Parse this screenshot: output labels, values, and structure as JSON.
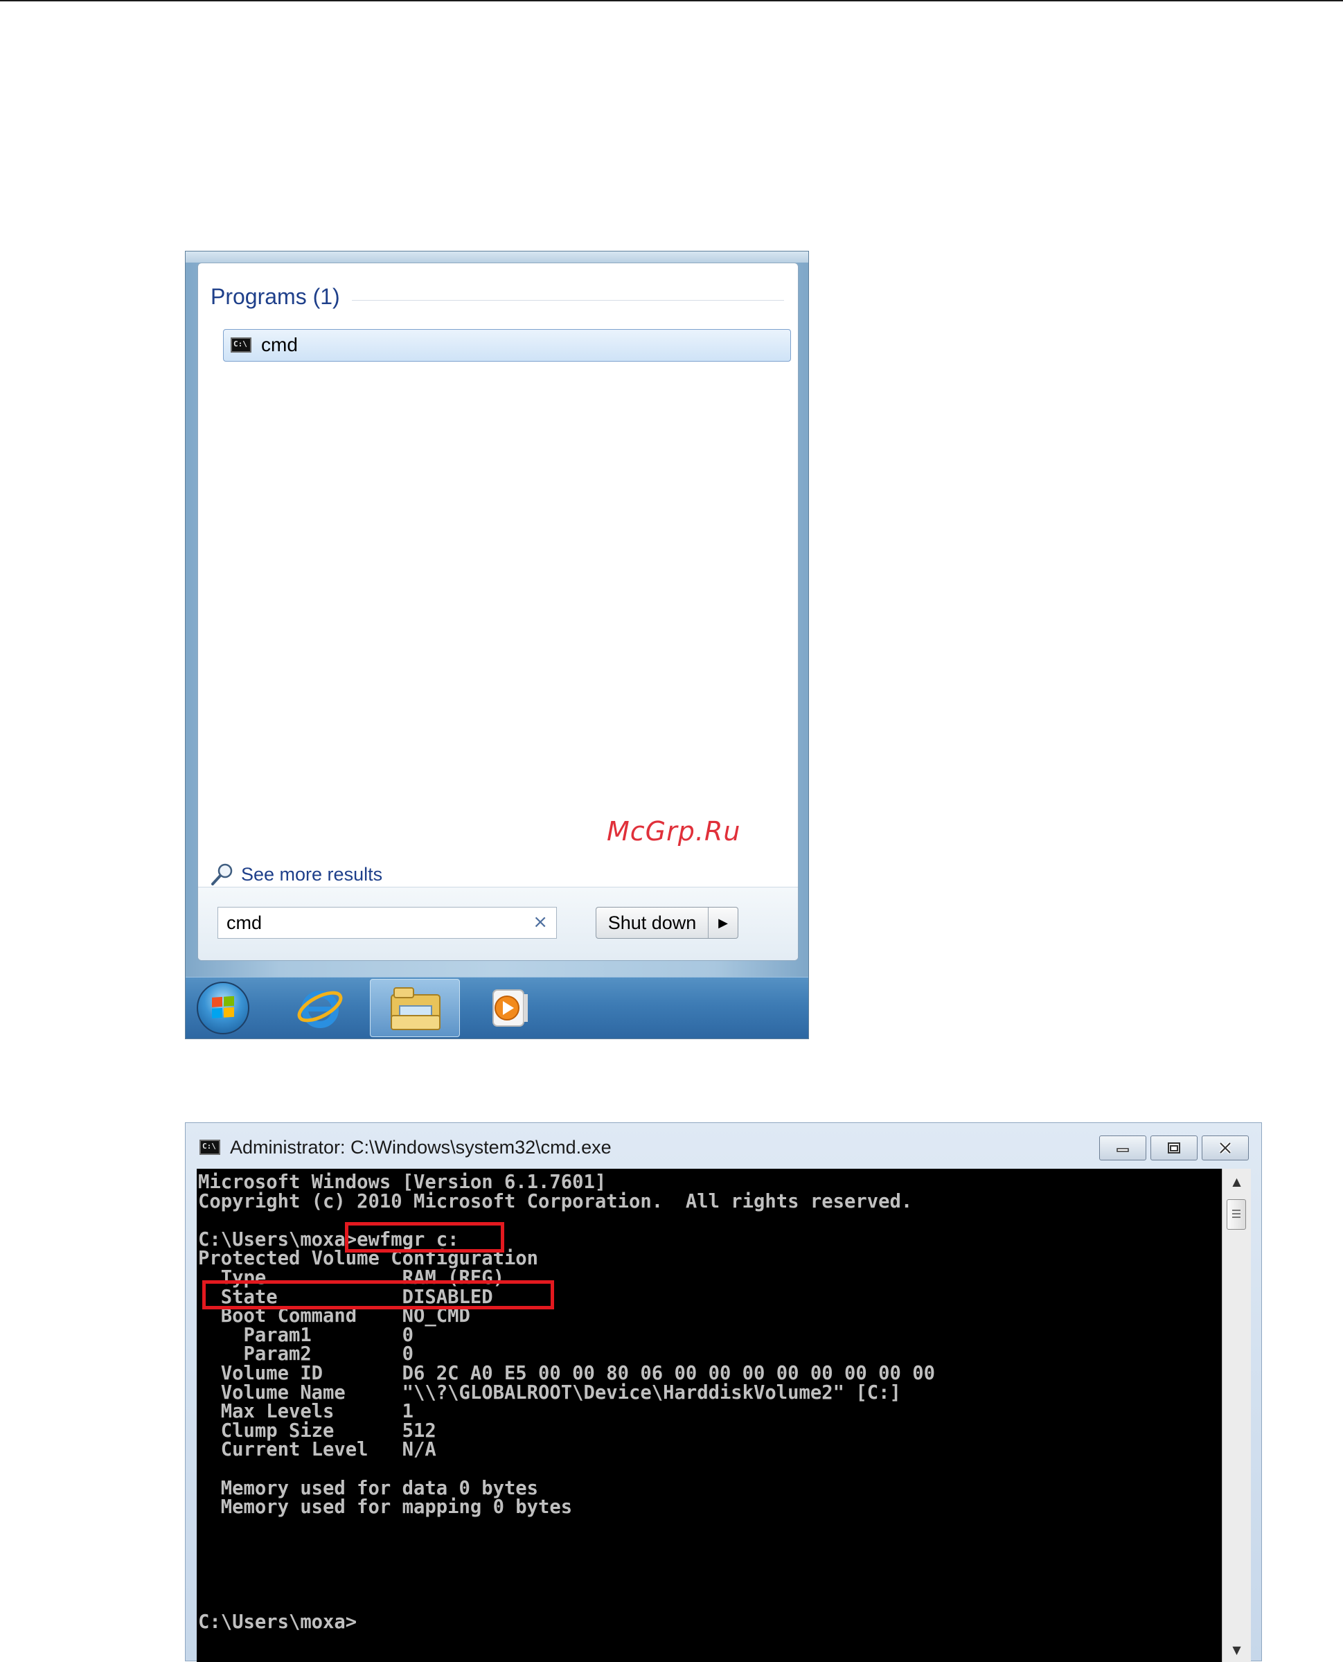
{
  "start_menu": {
    "programs_heading": "Programs (1)",
    "program_items": [
      {
        "label": "cmd",
        "icon": "cmd-icon"
      }
    ],
    "see_more_label": "See more results",
    "search_value": "cmd",
    "clear_glyph": "×",
    "shutdown_label": "Shut down",
    "shutdown_arrow": "▶",
    "watermark": "McGrp.Ru"
  },
  "taskbar": {
    "items": [
      "start-orb-icon",
      "internet-explorer-icon",
      "file-explorer-icon",
      "media-player-icon"
    ]
  },
  "cmd_window": {
    "title": "Administrator: C:\\Windows\\system32\\cmd.exe",
    "icon_text": "C:\\",
    "buttons": {
      "minimize": "minimize-icon",
      "maximize": "maximize-icon",
      "close": "close-icon"
    },
    "console_lines": [
      "Microsoft Windows [Version 6.1.7601]",
      "Copyright (c) 2010 Microsoft Corporation.  All rights reserved.",
      "",
      "C:\\Users\\moxa>ewfmgr c:",
      "Protected Volume Configuration",
      "  Type            RAM (REG)",
      "  State           DISABLED",
      "  Boot Command    NO_CMD",
      "    Param1        0",
      "    Param2        0",
      "  Volume ID       D6 2C A0 E5 00 00 80 06 00 00 00 00 00 00 00 00",
      "  Volume Name     \"\\\\?\\GLOBALROOT\\Device\\HarddiskVolume2\" [C:]",
      "  Max Levels      1",
      "  Clump Size      512",
      "  Current Level   N/A",
      "",
      "  Memory used for data 0 bytes",
      "  Memory used for mapping 0 bytes",
      "",
      "",
      "",
      "",
      "",
      "C:\\Users\\moxa>"
    ],
    "highlight_color": "#e3191f"
  }
}
